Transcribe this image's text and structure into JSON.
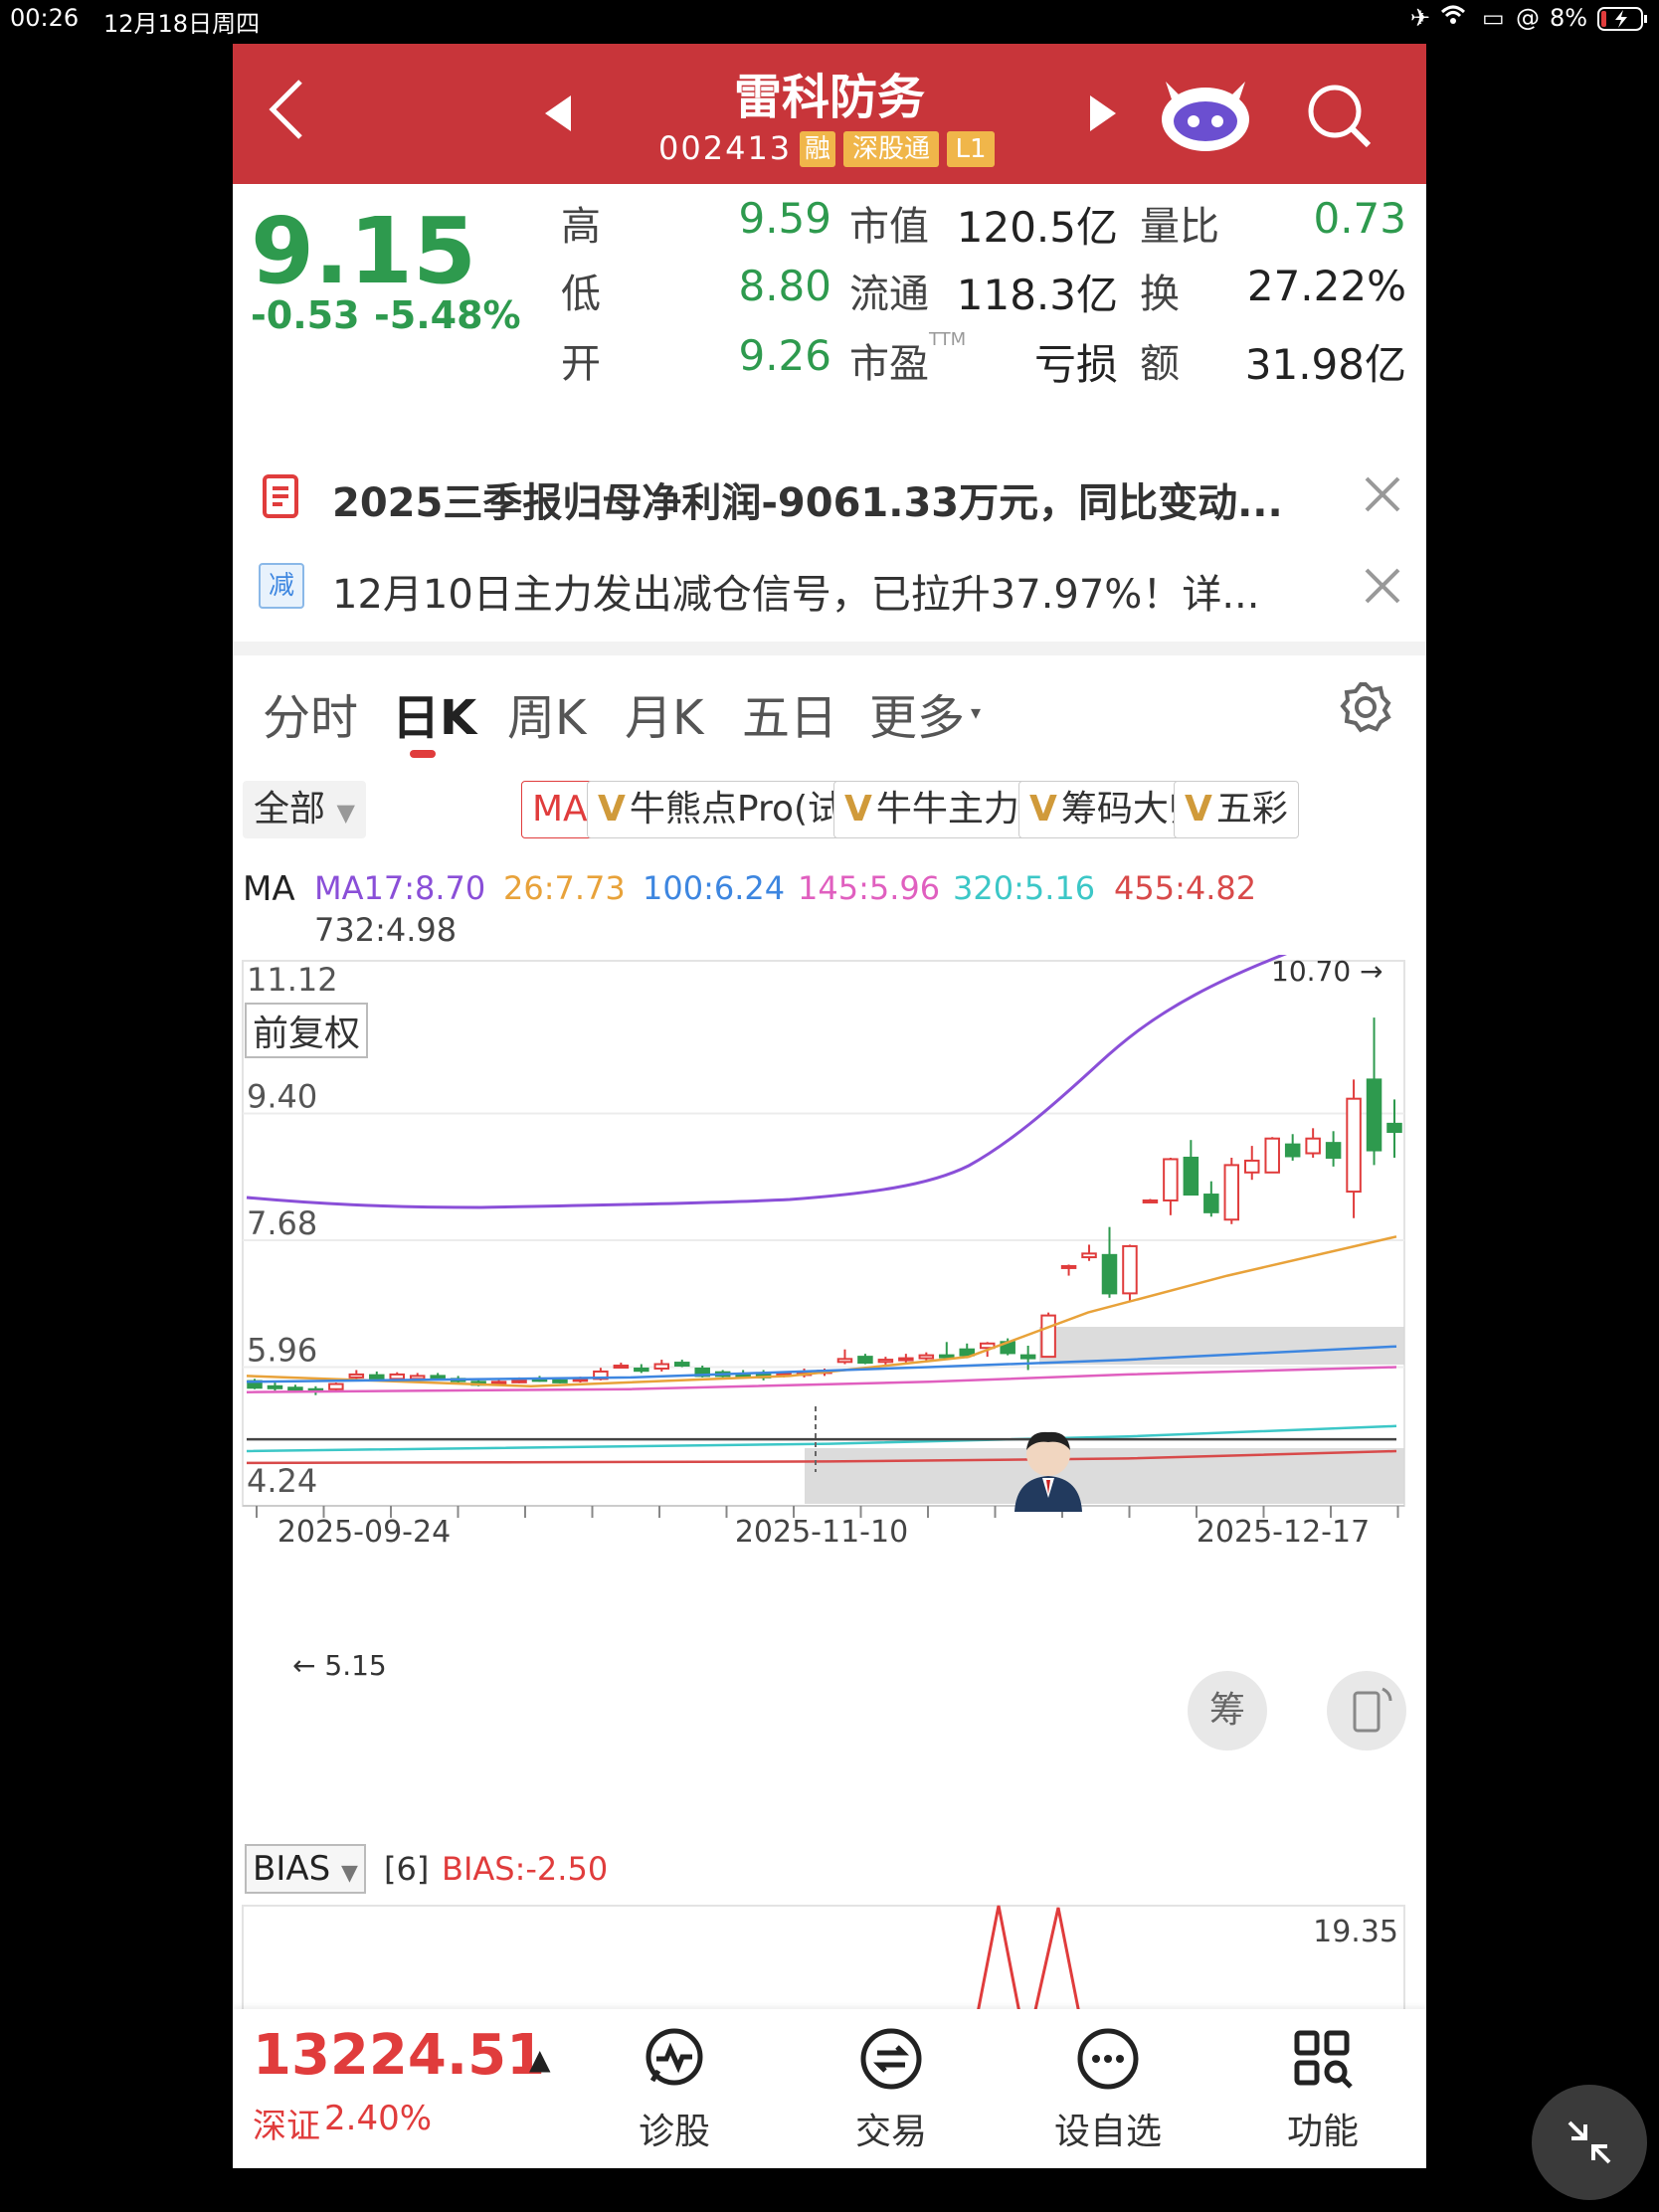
{
  "status_bar": {
    "time": "00:26",
    "date": "12月18日周四",
    "battery": "8%"
  },
  "header": {
    "stock_name": "雷科防务",
    "stock_code": "002413",
    "badges": [
      "融",
      "深股通",
      "L1"
    ]
  },
  "quote": {
    "price": "9.15",
    "change": "-0.53",
    "change_pct": "-5.48%",
    "high_label": "高",
    "high": "9.59",
    "low_label": "低",
    "low": "8.80",
    "open_label": "开",
    "open": "9.26",
    "mcap_label": "市值",
    "mcap": "120.5亿",
    "float_label": "流通",
    "float": "118.3亿",
    "pe_label": "市盈",
    "pe_suffix": "TTM",
    "pe": "亏损",
    "vr_label": "量比",
    "vr": "0.73",
    "turnover_label": "换",
    "turnover": "27.22%",
    "amount_label": "额",
    "amount": "31.98亿"
  },
  "notices": [
    {
      "text": "2025三季报归母净利润-9061.33万元，同比变动..."
    },
    {
      "badge": "减",
      "text": "12月10日主力发出减仓信号，已拉升37.97%！详..."
    }
  ],
  "tabs": [
    "分时",
    "日K",
    "周K",
    "月K",
    "五日",
    "更多"
  ],
  "indicator_chips": {
    "all": "全部",
    "ma": "MA",
    "items": [
      "牛熊点Pro(试用)",
      "牛牛主力宝",
      "筹码大师",
      "五彩"
    ]
  },
  "ma_legend": {
    "prefix": "MA",
    "items": [
      {
        "label": "MA17:8.70",
        "color": "#8a4fd8"
      },
      {
        "label": "26:7.73",
        "color": "#e8a23a"
      },
      {
        "label": "100:6.24",
        "color": "#3d86e0"
      },
      {
        "label": "145:5.96",
        "color": "#e05fbf"
      },
      {
        "label": "320:5.16",
        "color": "#3cc7c7"
      },
      {
        "label": "455:4.82",
        "color": "#d84a4a"
      },
      {
        "label": "732:4.98",
        "color": "#444444"
      }
    ]
  },
  "chart_labels": {
    "adj": "前复权",
    "high_marker": "10.70",
    "low_marker": "5.15",
    "chip_button": "筹"
  },
  "chart_data": {
    "type": "candlestick",
    "y_ticks": [
      "11.12",
      "9.40",
      "7.68",
      "5.96",
      "4.24"
    ],
    "x_ticks": [
      "2025-09-24",
      "2025-11-10",
      "2025-12-17"
    ],
    "ylim": [
      4.24,
      11.12
    ],
    "up_color": "#e03c3c",
    "down_color": "#2e9a4e",
    "candles": [
      [
        5.77,
        5.68,
        5.8,
        5.66
      ],
      [
        5.7,
        5.68,
        5.75,
        5.64
      ],
      [
        5.68,
        5.66,
        5.72,
        5.62
      ],
      [
        5.66,
        5.64,
        5.7,
        5.58
      ],
      [
        5.66,
        5.73,
        5.75,
        5.62
      ],
      [
        5.82,
        5.86,
        5.92,
        5.78
      ],
      [
        5.85,
        5.8,
        5.9,
        5.78
      ],
      [
        5.8,
        5.86,
        5.89,
        5.76
      ],
      [
        5.8,
        5.84,
        5.88,
        5.78
      ],
      [
        5.84,
        5.8,
        5.88,
        5.78
      ],
      [
        5.8,
        5.77,
        5.84,
        5.74
      ],
      [
        5.76,
        5.72,
        5.8,
        5.7
      ],
      [
        5.74,
        5.76,
        5.8,
        5.72
      ],
      [
        5.76,
        5.78,
        5.82,
        5.74
      ],
      [
        5.8,
        5.78,
        5.84,
        5.76
      ],
      [
        5.78,
        5.76,
        5.82,
        5.74
      ],
      [
        5.79,
        5.8,
        5.83,
        5.75
      ],
      [
        5.8,
        5.9,
        5.95,
        5.78
      ],
      [
        5.96,
        5.98,
        6.02,
        5.94
      ],
      [
        5.94,
        5.91,
        6.0,
        5.88
      ],
      [
        5.94,
        6.0,
        6.06,
        5.9
      ],
      [
        6.02,
        5.98,
        6.06,
        5.96
      ],
      [
        5.94,
        5.84,
        5.98,
        5.82
      ],
      [
        5.89,
        5.84,
        5.92,
        5.82
      ],
      [
        5.87,
        5.82,
        5.92,
        5.8
      ],
      [
        5.88,
        5.82,
        5.92,
        5.78
      ],
      [
        5.86,
        5.88,
        5.9,
        5.82
      ],
      [
        5.86,
        5.88,
        5.94,
        5.82
      ],
      [
        5.88,
        5.91,
        5.94,
        5.84
      ],
      [
        6.03,
        6.07,
        6.2,
        6.0
      ],
      [
        6.1,
        6.02,
        6.14,
        6.0
      ],
      [
        6.03,
        6.06,
        6.1,
        5.98
      ],
      [
        6.06,
        6.08,
        6.14,
        6.02
      ],
      [
        6.08,
        6.12,
        6.16,
        6.04
      ],
      [
        6.12,
        6.1,
        6.3,
        6.06
      ],
      [
        6.2,
        6.12,
        6.28,
        6.08
      ],
      [
        6.22,
        6.28,
        6.3,
        6.1
      ],
      [
        6.3,
        6.15,
        6.35,
        6.12
      ],
      [
        6.12,
        6.08,
        6.25,
        5.92
      ],
      [
        6.1,
        6.66,
        6.7,
        6.1
      ],
      [
        7.33,
        7.33,
        7.35,
        7.2
      ],
      [
        7.45,
        7.5,
        7.62,
        7.4
      ],
      [
        7.48,
        6.96,
        7.86,
        6.9
      ],
      [
        6.96,
        7.6,
        7.62,
        6.86
      ],
      [
        8.22,
        8.22,
        8.24,
        8.2
      ],
      [
        8.22,
        8.78,
        8.8,
        8.02
      ],
      [
        8.8,
        8.3,
        9.04,
        8.3
      ],
      [
        8.3,
        8.06,
        8.48,
        8.0
      ],
      [
        7.96,
        8.7,
        8.8,
        7.9
      ],
      [
        8.6,
        8.76,
        8.96,
        8.5
      ],
      [
        8.6,
        9.06,
        9.08,
        8.6
      ],
      [
        8.98,
        8.82,
        9.12,
        8.76
      ],
      [
        8.86,
        9.06,
        9.2,
        8.8
      ],
      [
        9.0,
        8.8,
        9.16,
        8.68
      ],
      [
        8.34,
        9.6,
        9.86,
        7.98
      ],
      [
        9.86,
        8.9,
        10.7,
        8.7
      ],
      [
        9.26,
        9.15,
        9.59,
        8.8
      ]
    ],
    "bias": {
      "label": "BIAS",
      "period": "[6]",
      "value": "BIAS:-2.50",
      "top_tick": "19.35"
    }
  },
  "bottom_bar": {
    "index_value": "13224.51",
    "index_name": "深证",
    "index_pct": "2.40%",
    "items": [
      "诊股",
      "交易",
      "设自选",
      "功能"
    ]
  }
}
